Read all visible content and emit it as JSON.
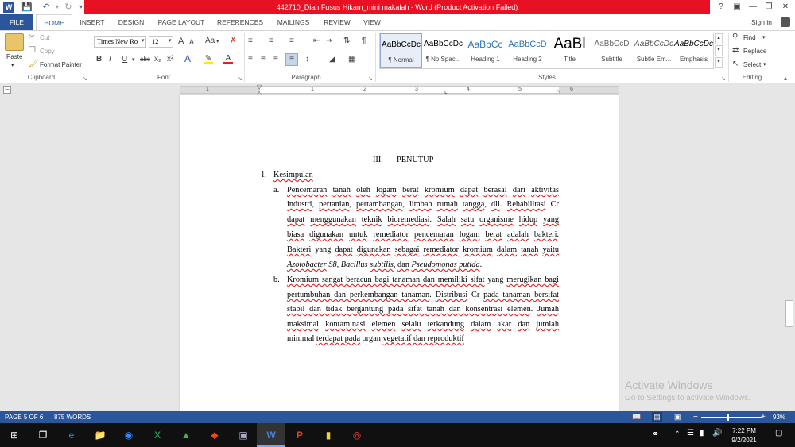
{
  "window": {
    "title": "442710_Dian Fusus Hikam_mini makalah -  Word (Product Activation Failed)",
    "help": "?",
    "sign_in": "Sign in"
  },
  "qat": {
    "word_icon": "W",
    "save_icon": "save-icon",
    "undo_icon": "undo-icon",
    "redo_icon": "redo-icon"
  },
  "tabs": [
    "FILE",
    "HOME",
    "INSERT",
    "DESIGN",
    "PAGE LAYOUT",
    "REFERENCES",
    "MAILINGS",
    "REVIEW",
    "VIEW"
  ],
  "clipboard": {
    "paste": "Paste",
    "cut": "Cut",
    "copy": "Copy",
    "format_painter": "Format Painter",
    "label": "Clipboard"
  },
  "font": {
    "name": "Times New Ro",
    "size": "12",
    "label": "Font",
    "grow": "A",
    "aa": "Aa",
    "bold": "B",
    "italic": "I",
    "underline": "U",
    "strike": "abc",
    "sub": "x₂",
    "sup": "x²"
  },
  "paragraph": {
    "label": "Paragraph"
  },
  "styles": {
    "label": "Styles",
    "items": [
      {
        "preview": "AaBbCcDc",
        "name": "¶ Normal"
      },
      {
        "preview": "AaBbCcDc",
        "name": "¶ No Spac..."
      },
      {
        "preview": "AaBbCc",
        "name": "Heading 1"
      },
      {
        "preview": "AaBbCcD",
        "name": "Heading 2"
      },
      {
        "preview": "AaBl",
        "name": "Title"
      },
      {
        "preview": "AaBbCcD",
        "name": "Subtitle"
      },
      {
        "preview": "AaBbCcDc",
        "name": "Subtle Em..."
      },
      {
        "preview": "AaBbCcDc",
        "name": "Emphasis"
      }
    ]
  },
  "editing": {
    "find": "Find",
    "replace": "Replace",
    "select": "Select",
    "label": "Editing"
  },
  "ruler": {
    "numbers": [
      "1",
      "1",
      "2",
      "3",
      "4",
      "5",
      "6"
    ]
  },
  "document": {
    "heading_num": "III.",
    "heading": "PENUTUP",
    "list_num": "1.",
    "list_title": "Kesimpulan",
    "a_marker": "a.",
    "b_marker": "b."
  },
  "watermark": {
    "line1": "Activate Windows",
    "line2": "Go to Settings to activate Windows."
  },
  "status": {
    "page": "PAGE 5 OF 6",
    "words": "875 WORDS",
    "zoom": "93%"
  },
  "taskbar": {
    "time": "7:22 PM",
    "date": "9/2/2021"
  }
}
